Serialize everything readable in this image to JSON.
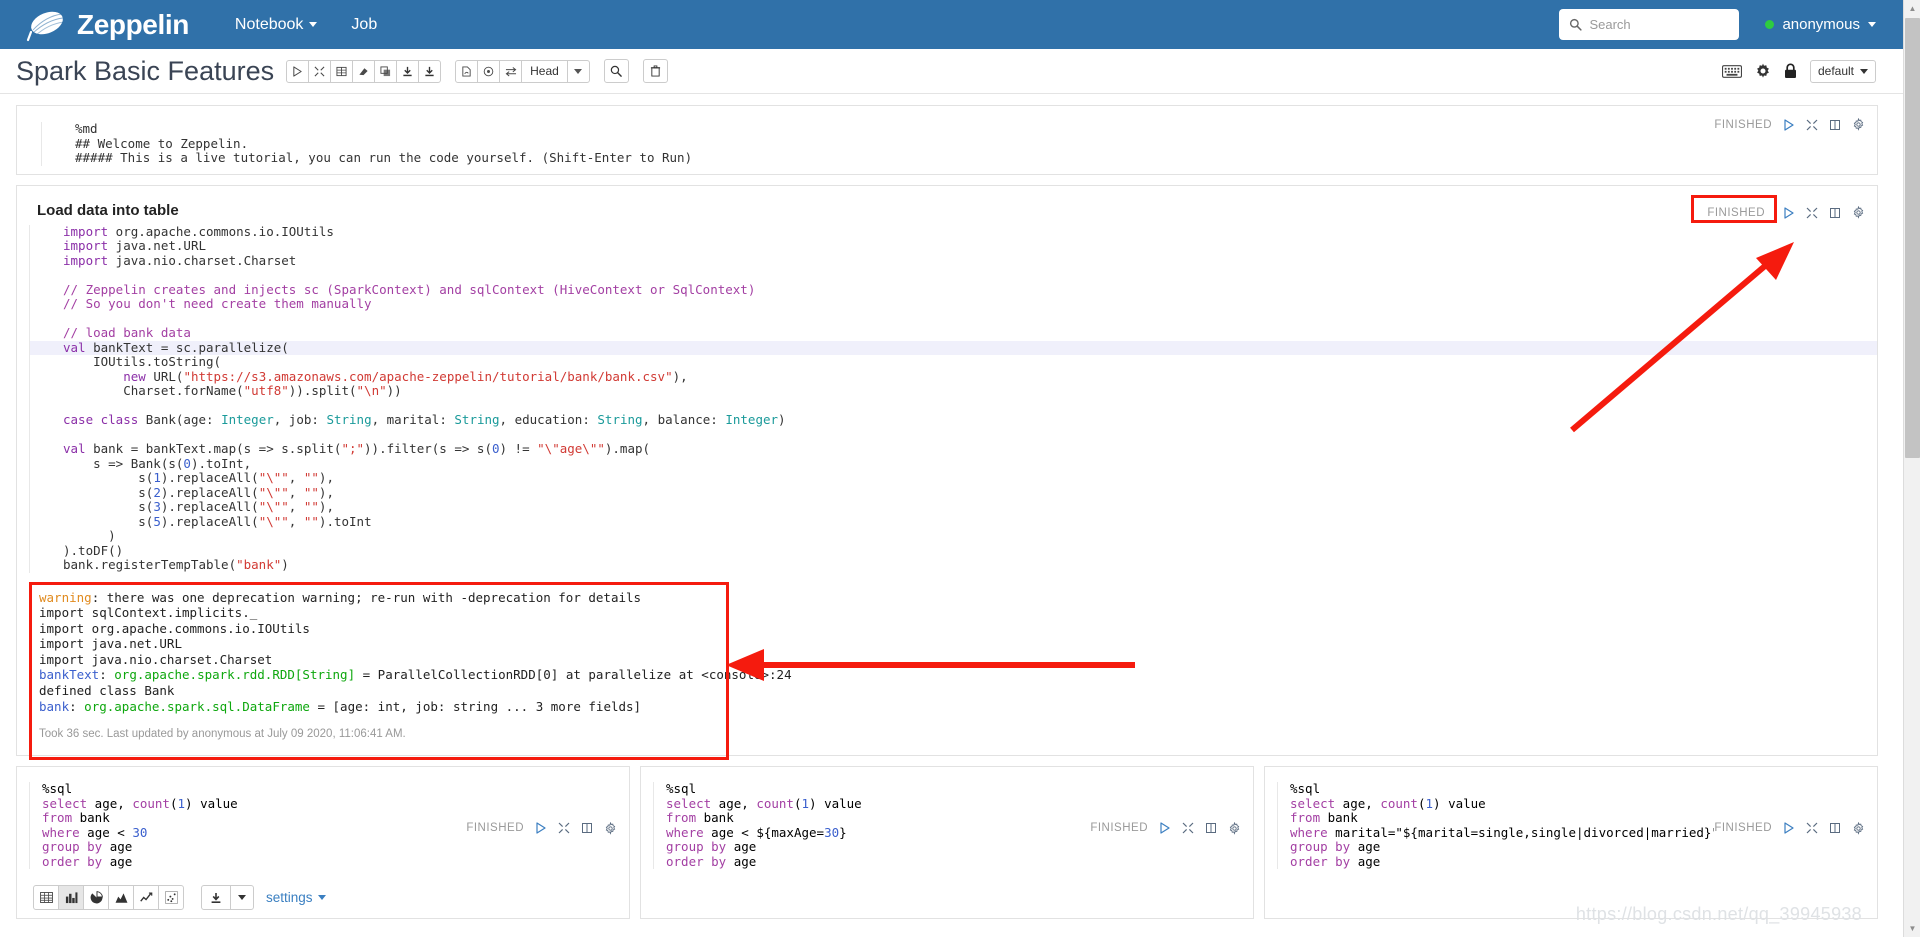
{
  "navbar": {
    "brand": "Zeppelin",
    "links": [
      {
        "label": "Notebook",
        "has_caret": true
      },
      {
        "label": "Job",
        "has_caret": false
      }
    ],
    "search_placeholder": "Search",
    "user": "anonymous",
    "user_status_color": "#2ecc40",
    "background_color": "#3071a9"
  },
  "titlebar": {
    "notebook_title": "Spark Basic Features",
    "run_group": [
      {
        "name": "run-all-paragraphs-icon",
        "glyph": "▷"
      },
      {
        "name": "collapse-all-icon",
        "glyph": "╳"
      },
      {
        "name": "show-hide-code-icon",
        "glyph": "⌸"
      },
      {
        "name": "clear-output-icon",
        "glyph": "◤"
      },
      {
        "name": "clone-notebook-icon",
        "glyph": "❐"
      },
      {
        "name": "export-notebook-icon",
        "glyph": "⬇"
      },
      {
        "name": "import-notebook-icon",
        "glyph": "⬇"
      }
    ],
    "version_group": [
      {
        "name": "commit-notebook-icon",
        "glyph": "⎘"
      },
      {
        "name": "schedule-cron-icon",
        "glyph": "⊙"
      },
      {
        "name": "compare-revision-icon",
        "glyph": "⇄"
      }
    ],
    "revision_label": "Head",
    "search_icon": "ὐd",
    "trash_icon": "Ὕ1",
    "right_icons": [
      {
        "name": "keyboard-shortcuts-icon"
      },
      {
        "name": "gear-icon"
      },
      {
        "name": "lock-permissions-icon"
      }
    ],
    "interpreter_binding": "default"
  },
  "paragraphs": [
    {
      "id": "md-welcome",
      "title": null,
      "status": "FINISHED",
      "controls": [
        "run-icon",
        "collapse-icon",
        "book-icon",
        "gear-icon"
      ],
      "code_lines": [
        [
          {
            "t": "%md",
            "c": ""
          }
        ],
        [
          {
            "t": "## Welcome to Zeppelin.",
            "c": ""
          }
        ],
        [
          {
            "t": "##### This is a live tutorial, you can run the code yourself. (Shift-Enter to Run)",
            "c": ""
          }
        ]
      ]
    },
    {
      "id": "load-data-into-table",
      "title": "Load data into table",
      "status": "FINISHED",
      "status_highlighted": true,
      "controls": [
        "run-icon",
        "collapse-icon",
        "book-icon",
        "gear-icon"
      ],
      "code_lines": [
        [
          {
            "t": "import",
            "c": "kw"
          },
          {
            "t": " org.apache.commons.io.IOUtils",
            "c": ""
          }
        ],
        [
          {
            "t": "import",
            "c": "kw"
          },
          {
            "t": " java.net.URL",
            "c": ""
          }
        ],
        [
          {
            "t": "import",
            "c": "kw"
          },
          {
            "t": " java.nio.charset.Charset",
            "c": ""
          }
        ],
        [
          {
            "t": "",
            "c": ""
          }
        ],
        [
          {
            "t": "// Zeppelin creates and injects sc (SparkContext) and sqlContext (HiveContext or SqlContext)",
            "c": "cmt"
          }
        ],
        [
          {
            "t": "// So you don't need create them manually",
            "c": "cmt"
          }
        ],
        [
          {
            "t": "",
            "c": ""
          }
        ],
        [
          {
            "t": "// load bank data",
            "c": "cmt"
          }
        ],
        [
          {
            "t": "val",
            "c": "kw"
          },
          {
            "t": " bankText = sc.parallelize(",
            "c": ""
          }
        ],
        [
          {
            "t": "    IOUtils.toString(",
            "c": ""
          }
        ],
        [
          {
            "t": "        ",
            "c": ""
          },
          {
            "t": "new",
            "c": "kw"
          },
          {
            "t": " URL(",
            "c": ""
          },
          {
            "t": "\"https://s3.amazonaws.com/apache-zeppelin/tutorial/bank/bank.csv\"",
            "c": "str"
          },
          {
            "t": "),",
            "c": ""
          }
        ],
        [
          {
            "t": "        Charset.forName(",
            "c": ""
          },
          {
            "t": "\"utf8\"",
            "c": "str"
          },
          {
            "t": ")).split(",
            "c": ""
          },
          {
            "t": "\"\\n\"",
            "c": "str"
          },
          {
            "t": "))",
            "c": ""
          }
        ],
        [
          {
            "t": "",
            "c": ""
          }
        ],
        [
          {
            "t": "case class",
            "c": "kw"
          },
          {
            "t": " Bank(age: ",
            "c": ""
          },
          {
            "t": "Integer",
            "c": "typ"
          },
          {
            "t": ", job: ",
            "c": ""
          },
          {
            "t": "String",
            "c": "typ"
          },
          {
            "t": ", marital: ",
            "c": ""
          },
          {
            "t": "String",
            "c": "typ"
          },
          {
            "t": ", education: ",
            "c": ""
          },
          {
            "t": "String",
            "c": "typ"
          },
          {
            "t": ", balance: ",
            "c": ""
          },
          {
            "t": "Integer",
            "c": "typ"
          },
          {
            "t": ")",
            "c": ""
          }
        ],
        [
          {
            "t": "",
            "c": ""
          }
        ],
        [
          {
            "t": "val",
            "c": "kw"
          },
          {
            "t": " bank = bankText.map(s => s.split(",
            "c": ""
          },
          {
            "t": "\";\"",
            "c": "str"
          },
          {
            "t": ")).filter(s => s(",
            "c": ""
          },
          {
            "t": "0",
            "c": "num"
          },
          {
            "t": ") != ",
            "c": ""
          },
          {
            "t": "\"\\\"age\\\"\"",
            "c": "str"
          },
          {
            "t": ").map(",
            "c": ""
          }
        ],
        [
          {
            "t": "    s => Bank(s(",
            "c": ""
          },
          {
            "t": "0",
            "c": "num"
          },
          {
            "t": ").toInt,",
            "c": ""
          }
        ],
        [
          {
            "t": "          s(",
            "c": ""
          },
          {
            "t": "1",
            "c": "num"
          },
          {
            "t": ").replaceAll(",
            "c": ""
          },
          {
            "t": "\"\\\"\"",
            "c": "str"
          },
          {
            "t": ", ",
            "c": ""
          },
          {
            "t": "\"\"",
            "c": "str"
          },
          {
            "t": "),",
            "c": ""
          }
        ],
        [
          {
            "t": "          s(",
            "c": ""
          },
          {
            "t": "2",
            "c": "num"
          },
          {
            "t": ").replaceAll(",
            "c": ""
          },
          {
            "t": "\"\\\"\"",
            "c": "str"
          },
          {
            "t": ", ",
            "c": ""
          },
          {
            "t": "\"\"",
            "c": "str"
          },
          {
            "t": "),",
            "c": ""
          }
        ],
        [
          {
            "t": "          s(",
            "c": ""
          },
          {
            "t": "3",
            "c": "num"
          },
          {
            "t": ").replaceAll(",
            "c": ""
          },
          {
            "t": "\"\\\"\"",
            "c": "str"
          },
          {
            "t": ", ",
            "c": ""
          },
          {
            "t": "\"\"",
            "c": "str"
          },
          {
            "t": "),",
            "c": ""
          }
        ],
        [
          {
            "t": "          s(",
            "c": ""
          },
          {
            "t": "5",
            "c": "num"
          },
          {
            "t": ").replaceAll(",
            "c": ""
          },
          {
            "t": "\"\\\"\"",
            "c": "str"
          },
          {
            "t": ", ",
            "c": ""
          },
          {
            "t": "\"\"",
            "c": "str"
          },
          {
            "t": ").toInt",
            "c": ""
          }
        ],
        [
          {
            "t": "      )",
            "c": ""
          }
        ],
        [
          {
            "t": ").toDF()",
            "c": ""
          }
        ],
        [
          {
            "t": "bank.registerTempTable(",
            "c": ""
          },
          {
            "t": "\"bank\"",
            "c": "str"
          },
          {
            "t": ")",
            "c": ""
          }
        ]
      ],
      "output_lines": [
        [
          {
            "t": "warning",
            "c": "o-warn"
          },
          {
            "t": ": there was one deprecation warning; re-run with -deprecation for details",
            "c": ""
          }
        ],
        [
          {
            "t": "import sqlContext.implicits._",
            "c": ""
          }
        ],
        [
          {
            "t": "import org.apache.commons.io.IOUtils",
            "c": ""
          }
        ],
        [
          {
            "t": "import java.net.URL",
            "c": ""
          }
        ],
        [
          {
            "t": "import java.nio.charset.Charset",
            "c": ""
          }
        ],
        [
          {
            "t": "bankText",
            "c": "o-var"
          },
          {
            "t": ": ",
            "c": ""
          },
          {
            "t": "org.apache.spark.rdd.RDD[String]",
            "c": "o-typ"
          },
          {
            "t": " = ParallelCollectionRDD[0] at parallelize at <console>:24",
            "c": ""
          }
        ],
        [
          {
            "t": "defined class Bank",
            "c": ""
          }
        ],
        [
          {
            "t": "bank",
            "c": "o-var"
          },
          {
            "t": ": ",
            "c": ""
          },
          {
            "t": "org.apache.spark.sql.DataFrame",
            "c": "o-typ"
          },
          {
            "t": " = [age: int, job: string ... 3 more fields]",
            "c": ""
          }
        ]
      ],
      "took": "Took 36 sec. Last updated by anonymous at July 09 2020, 11:06:41 AM."
    }
  ],
  "sql_paragraphs": [
    {
      "id": "sql-age-under-30",
      "status": "FINISHED",
      "controls": [
        "run-icon",
        "collapse-icon",
        "book-icon",
        "gear-icon"
      ],
      "code_lines": [
        [
          {
            "t": "%sql",
            "c": ""
          }
        ],
        [
          {
            "t": "select",
            "c": "cmt"
          },
          {
            "t": " age, ",
            "c": ""
          },
          {
            "t": "count",
            "c": "cmt"
          },
          {
            "t": "(",
            "c": ""
          },
          {
            "t": "1",
            "c": "num"
          },
          {
            "t": ") value",
            "c": ""
          }
        ],
        [
          {
            "t": "from",
            "c": "cmt"
          },
          {
            "t": " bank",
            "c": ""
          }
        ],
        [
          {
            "t": "where",
            "c": "cmt"
          },
          {
            "t": " age < ",
            "c": ""
          },
          {
            "t": "30",
            "c": "num"
          }
        ],
        [
          {
            "t": "group by",
            "c": "cmt"
          },
          {
            "t": " age",
            "c": ""
          }
        ],
        [
          {
            "t": "order by",
            "c": "cmt"
          },
          {
            "t": " age",
            "c": ""
          }
        ]
      ],
      "has_viz_bar": true,
      "viz_buttons": [
        {
          "name": "viz-table-icon",
          "active": false
        },
        {
          "name": "viz-bar-chart-icon",
          "active": true
        },
        {
          "name": "viz-pie-chart-icon",
          "active": false
        },
        {
          "name": "viz-area-chart-icon",
          "active": false
        },
        {
          "name": "viz-line-chart-icon",
          "active": false
        },
        {
          "name": "viz-scatter-chart-icon",
          "active": false
        }
      ],
      "download_label": "download-data-icon",
      "settings_label": "settings"
    },
    {
      "id": "sql-age-dynamic-form",
      "status": "FINISHED",
      "controls": [
        "run-icon",
        "collapse-icon",
        "book-icon",
        "gear-icon"
      ],
      "code_lines": [
        [
          {
            "t": "%sql",
            "c": ""
          }
        ],
        [
          {
            "t": "select",
            "c": "cmt"
          },
          {
            "t": " age, ",
            "c": ""
          },
          {
            "t": "count",
            "c": "cmt"
          },
          {
            "t": "(",
            "c": ""
          },
          {
            "t": "1",
            "c": "num"
          },
          {
            "t": ") value",
            "c": ""
          }
        ],
        [
          {
            "t": "from",
            "c": "cmt"
          },
          {
            "t": " bank",
            "c": ""
          }
        ],
        [
          {
            "t": "where",
            "c": "cmt"
          },
          {
            "t": " age < ${maxAge=",
            "c": ""
          },
          {
            "t": "30",
            "c": "num"
          },
          {
            "t": "}",
            "c": ""
          }
        ],
        [
          {
            "t": "group by",
            "c": "cmt"
          },
          {
            "t": " age",
            "c": ""
          }
        ],
        [
          {
            "t": "order by",
            "c": "cmt"
          },
          {
            "t": " age",
            "c": ""
          }
        ]
      ],
      "has_viz_bar": false
    },
    {
      "id": "sql-marital-select-form",
      "status": "FINISHED",
      "controls": [
        "run-icon",
        "collapse-icon",
        "book-icon",
        "gear-icon"
      ],
      "code_lines": [
        [
          {
            "t": "%sql",
            "c": ""
          }
        ],
        [
          {
            "t": "select",
            "c": "cmt"
          },
          {
            "t": " age, ",
            "c": ""
          },
          {
            "t": "count",
            "c": "cmt"
          },
          {
            "t": "(",
            "c": ""
          },
          {
            "t": "1",
            "c": "num"
          },
          {
            "t": ") value",
            "c": ""
          }
        ],
        [
          {
            "t": "from",
            "c": "cmt"
          },
          {
            "t": " bank",
            "c": ""
          }
        ],
        [
          {
            "t": "where",
            "c": "cmt"
          },
          {
            "t": " marital=\"${marital=single,single|divorced|married}\"",
            "c": ""
          }
        ],
        [
          {
            "t": "group by",
            "c": "cmt"
          },
          {
            "t": " age",
            "c": ""
          }
        ],
        [
          {
            "t": "order by",
            "c": "cmt"
          },
          {
            "t": " age",
            "c": ""
          }
        ]
      ],
      "has_viz_bar": false
    }
  ],
  "annotations": {
    "highlight_color": "#f51b0e",
    "arrow_count": 2
  },
  "watermark": "https://blog.csdn.net/qq_39945938"
}
